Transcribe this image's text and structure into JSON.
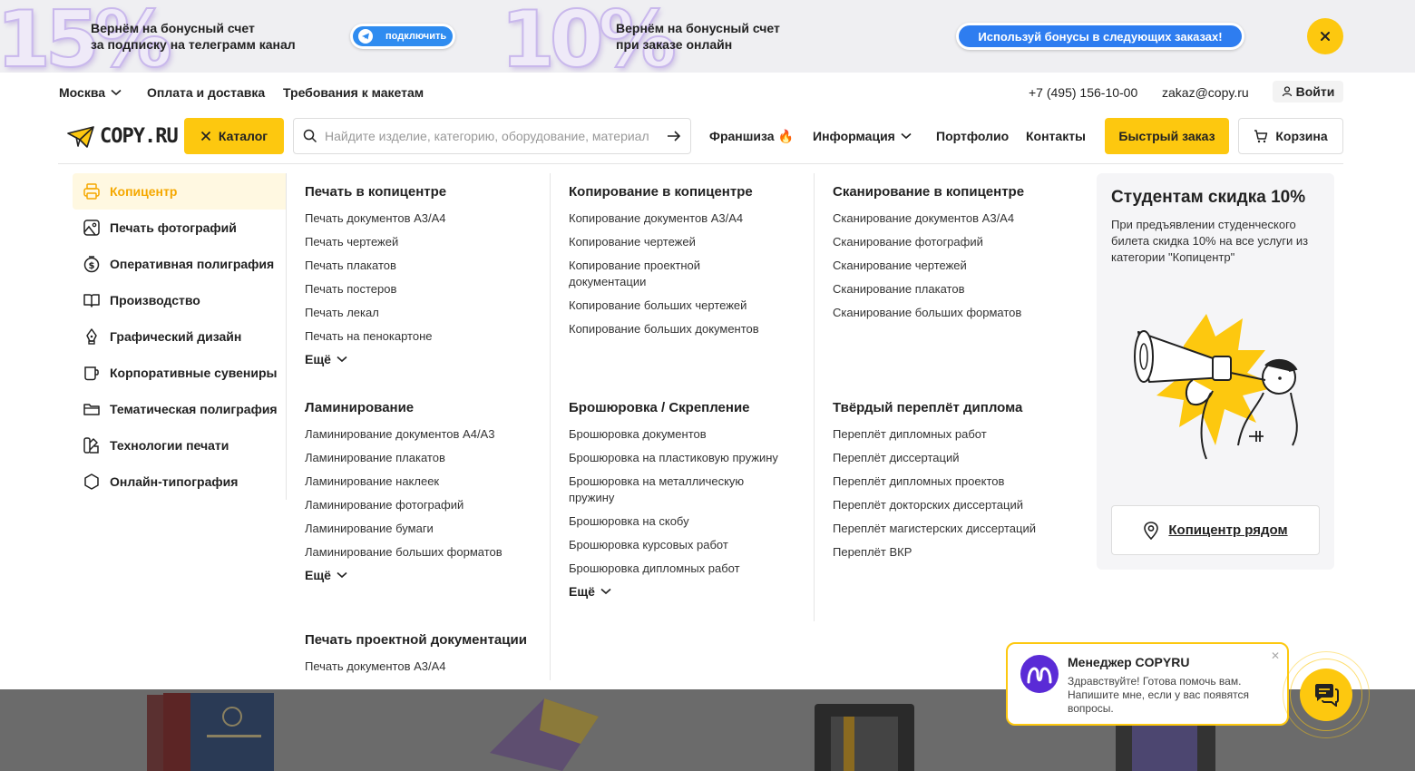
{
  "promo": {
    "num1": "15%",
    "text1_line1": "Вернём на бонусный счет",
    "text1_line2": "за подписку на телеграмм канал",
    "subscribe_label": "подключить",
    "num2": "10%",
    "text2_line1": "Вернём на бонусный счет",
    "text2_line2": "при заказе онлайн",
    "bonus_label": "Используй бонусы в следующих заказах!"
  },
  "topbar": {
    "city": "Москва",
    "payment": "Оплата и доставка",
    "requirements": "Требования к макетам",
    "phone": "+7 (495) 156-10-00",
    "email": "zakaz@copy.ru",
    "login": "Войти"
  },
  "header": {
    "logo": "COPY.RU",
    "catalog": "Каталог",
    "search_placeholder": "Найдите изделие, категорию, оборудование, материал",
    "franchise": "Франшиза 🔥",
    "info": "Информация",
    "portfolio": "Портфолио",
    "contacts": "Контакты",
    "fast_order": "Быстрый заказ",
    "cart": "Корзина"
  },
  "sidebar": {
    "items": [
      {
        "label": "Копицентр",
        "icon": "printer-icon"
      },
      {
        "label": "Печать фотографий",
        "icon": "photo-icon"
      },
      {
        "label": "Оперативная полиграфия",
        "icon": "money-icon"
      },
      {
        "label": "Производство",
        "icon": "book-icon"
      },
      {
        "label": "Графический дизайн",
        "icon": "pen-nib-icon"
      },
      {
        "label": "Корпоративные сувениры",
        "icon": "mug-icon"
      },
      {
        "label": "Тематическая полиграфия",
        "icon": "folder-icon"
      },
      {
        "label": "Технологии печати",
        "icon": "palette-icon"
      },
      {
        "label": "Онлайн-типография",
        "icon": "hexagon-icon"
      }
    ]
  },
  "menu": {
    "more": "Ещё",
    "print": {
      "title": "Печать в копицентре",
      "links": [
        "Печать документов А3/А4",
        "Печать чертежей",
        "Печать плакатов",
        "Печать постеров",
        "Печать лекал",
        "Печать на пенокартоне"
      ]
    },
    "lamination": {
      "title": "Ламинирование",
      "links": [
        "Ламинирование документов А4/А3",
        "Ламинирование плакатов",
        "Ламинирование наклеек",
        "Ламинирование фотографий",
        "Ламинирование бумаги",
        "Ламинирование больших форматов"
      ]
    },
    "project": {
      "title": "Печать проектной документации",
      "links": [
        "Печать документов А3/А4"
      ]
    },
    "copy": {
      "title": "Копирование в копицентре",
      "links": [
        "Копирование документов А3/А4",
        "Копирование чертежей",
        "Копирование проектной документации",
        "Копирование больших чертежей",
        "Копирование больших документов"
      ]
    },
    "binding": {
      "title": "Брошюровка / Скрепление",
      "links": [
        "Брошюровка документов",
        "Брошюровка на пластиковую пружину",
        "Брошюровка на металлическую пружину",
        "Брошюровка на скобу",
        "Брошюровка курсовых работ",
        "Брошюровка дипломных работ"
      ]
    },
    "scan": {
      "title": "Сканирование в копицентре",
      "links": [
        "Сканирование документов А3/А4",
        "Сканирование фотографий",
        "Сканирование чертежей",
        "Сканирование плакатов",
        "Сканирование больших форматов"
      ]
    },
    "diploma": {
      "title": "Твёрдый переплёт диплома",
      "links": [
        "Переплёт дипломных работ",
        "Переплёт диссертаций",
        "Переплёт дипломных проектов",
        "Переплёт докторских диссертаций",
        "Переплёт магистерских диссертаций",
        "Переплёт ВКР"
      ]
    }
  },
  "promo_card": {
    "title": "Студентам скидка 10%",
    "text": "При предъявлении студенческого билета скидка 10% на все услуги из категории \"Копицентр\"",
    "nearby": "Копицентр рядом"
  },
  "chat": {
    "title": "Менеджер COPYRU",
    "text": "Здравствуйте! Готова помочь вам. Напишите мне, если у вас появятся вопросы."
  },
  "colors": {
    "accent": "#fdc80f",
    "telegram": "#2f8cf0",
    "bonus": "#2e7df0",
    "chat_avatar": "#5a2bd6"
  }
}
